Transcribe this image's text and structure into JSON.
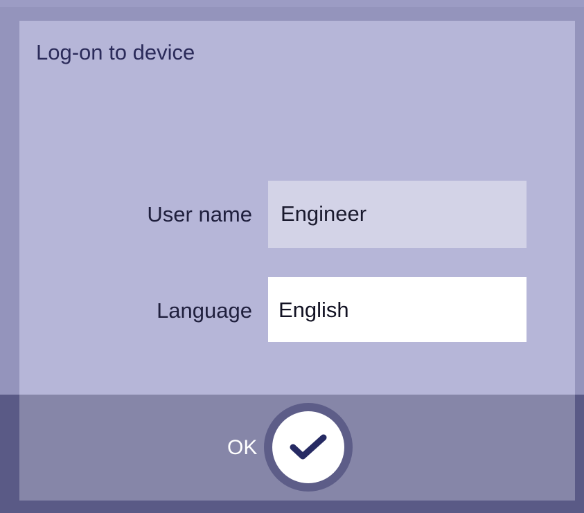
{
  "dialog": {
    "title": "Log-on to device"
  },
  "form": {
    "user_label": "User name",
    "user_value": "Engineer",
    "language_label": "Language",
    "language_value": "English"
  },
  "footer": {
    "ok_label": "OK",
    "ok_icon": "checkmark-icon"
  },
  "colors": {
    "panel": "#b6b6d8",
    "frame": "#9494bc",
    "footer": "#8686a8",
    "footer_edge": "#5a5a86",
    "accent": "#2b2b6a"
  }
}
